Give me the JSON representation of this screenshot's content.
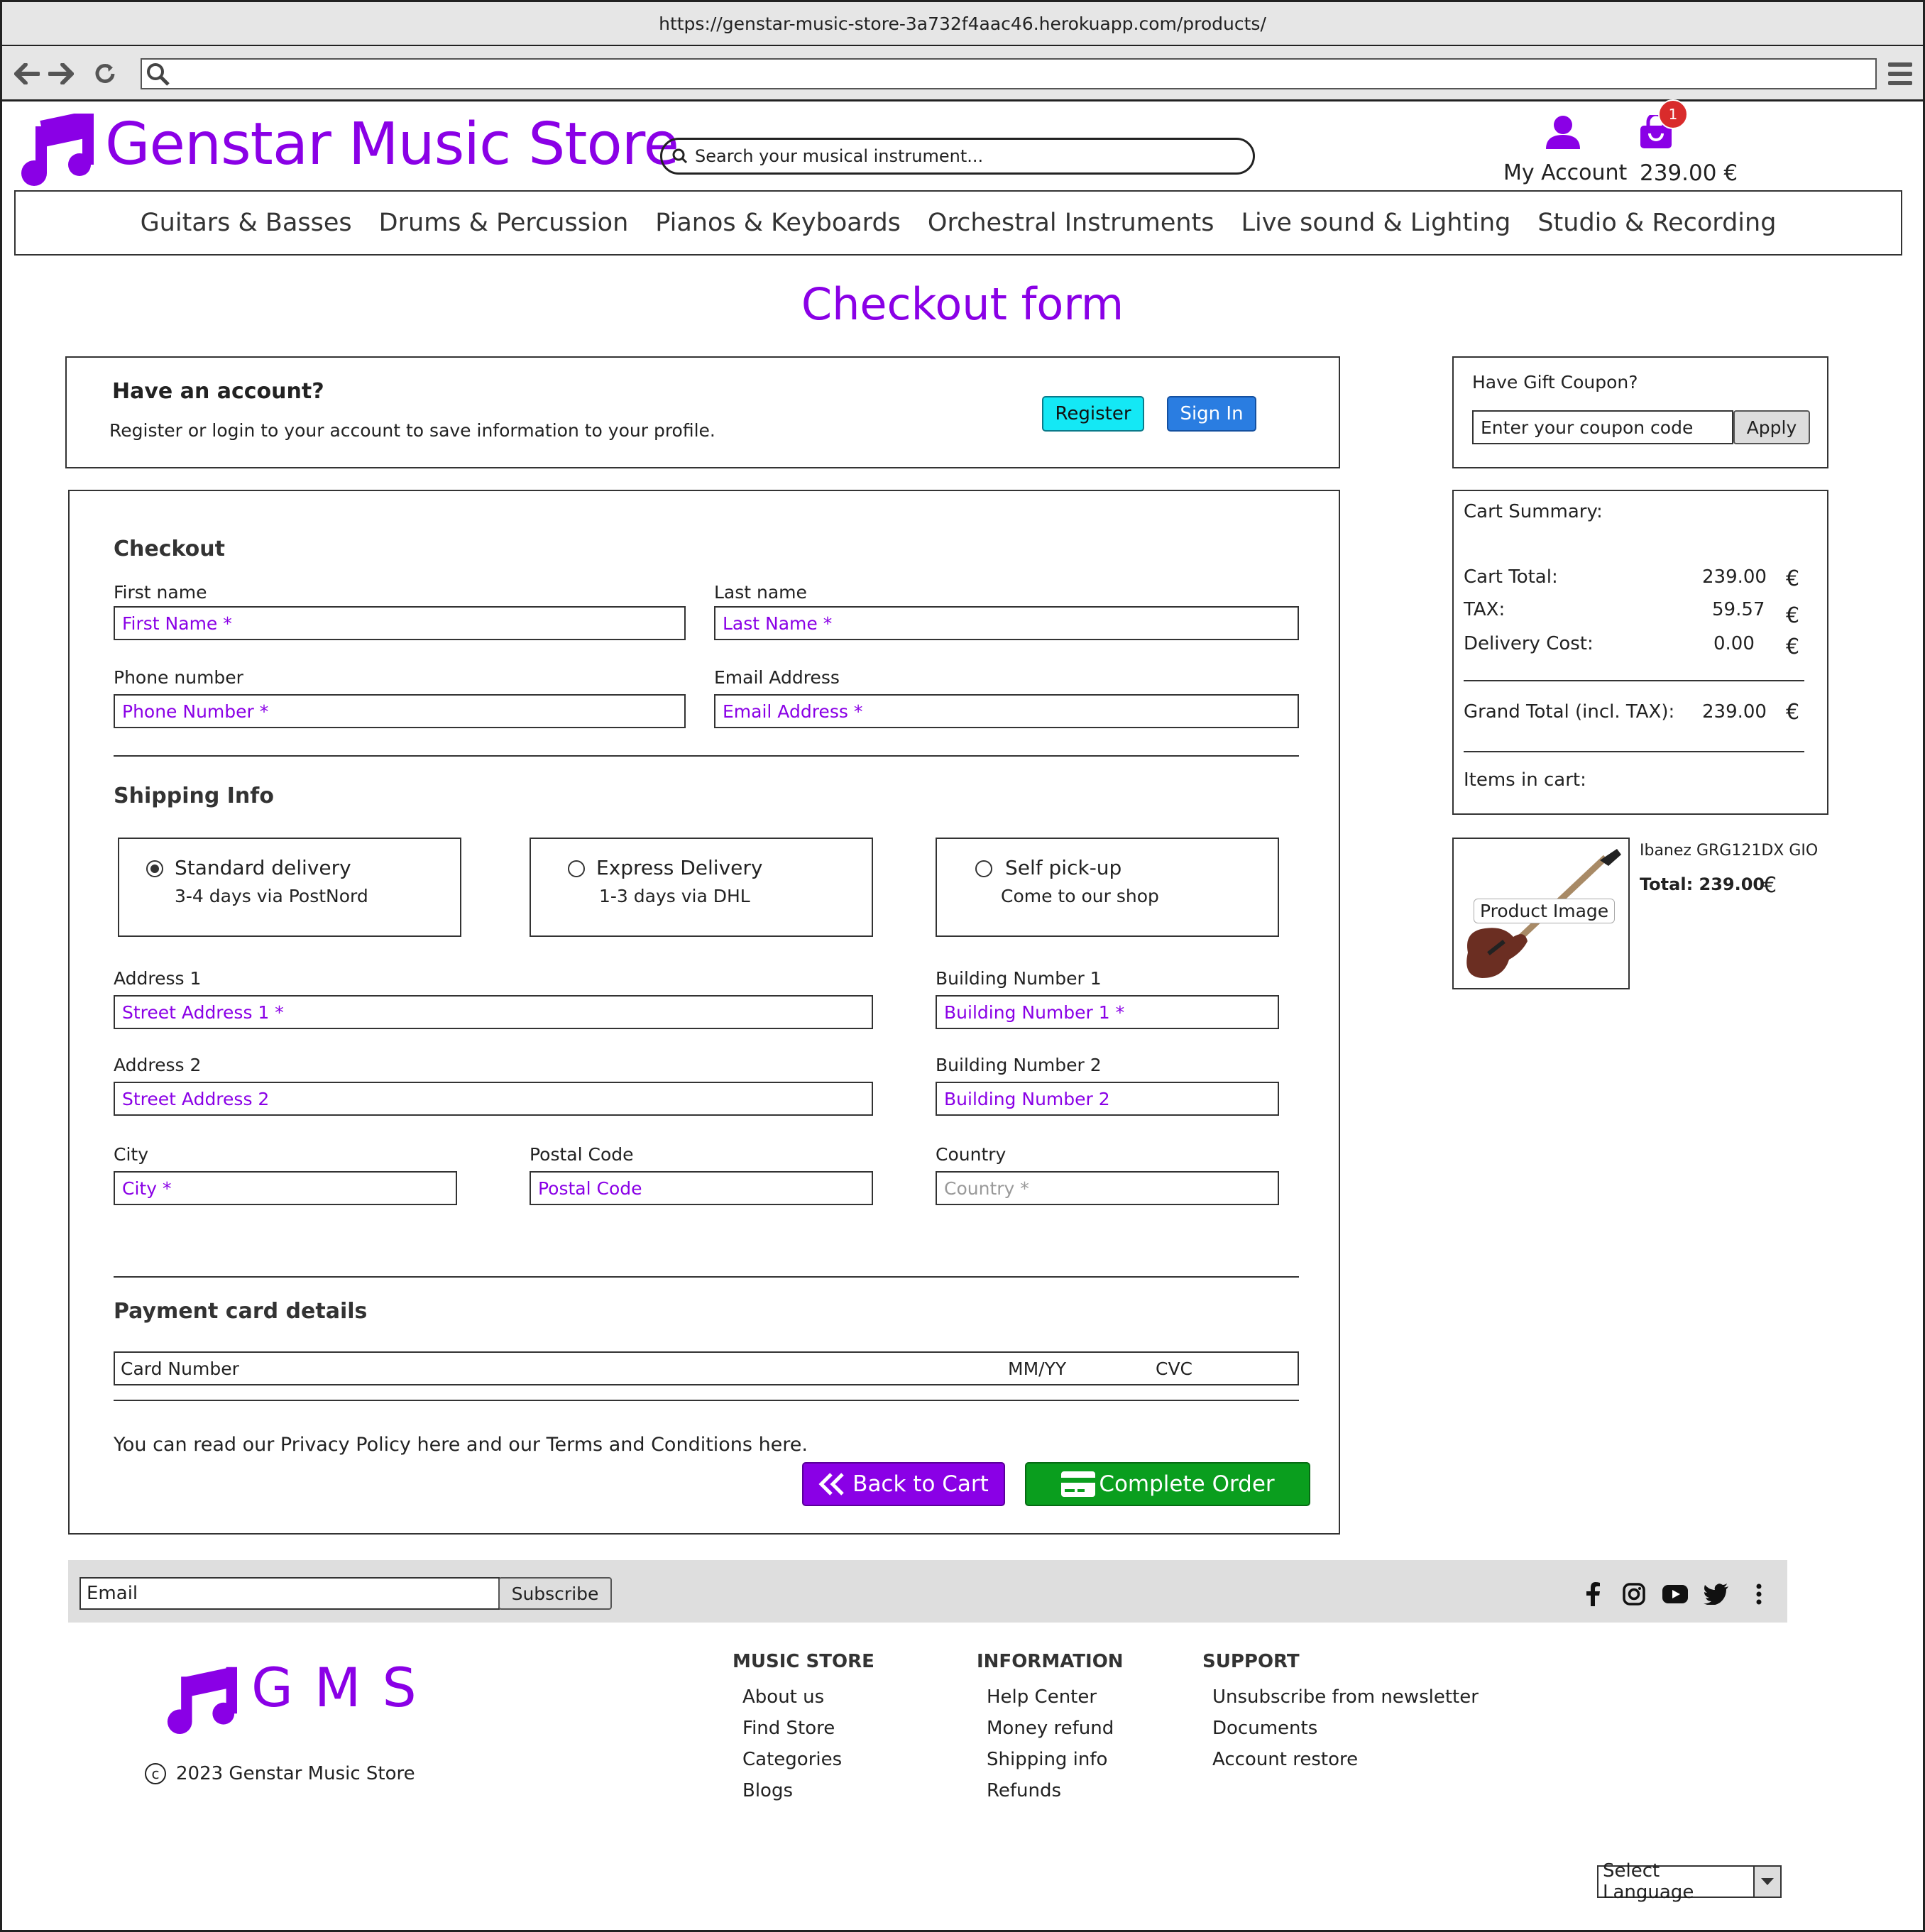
{
  "browser": {
    "url": "https://genstar-music-store-3a732f4aac46.herokuapp.com/products/",
    "back_icon": "arrow-left-icon",
    "forward_icon": "arrow-right-icon",
    "reload_icon": "reload-icon",
    "search_icon": "search-icon",
    "menu_icon": "hamburger-menu-icon"
  },
  "header": {
    "title": "Genstar Music Store",
    "search_placeholder": "Search your musical instrument...",
    "account_label": "My Account",
    "cart_total": "239.00 €",
    "cart_count": "1"
  },
  "nav": [
    "Guitars & Basses",
    "Drums & Percussion",
    "Pianos & Keyboards",
    "Orchestral Instruments",
    "Live sound & Lighting",
    "Studio & Recording"
  ],
  "page_title": "Checkout form",
  "account_box": {
    "heading": "Have an account?",
    "text": "Register or login to your account to save information to your profile.",
    "register": "Register",
    "signin": "Sign In"
  },
  "coupon": {
    "label": "Have Gift Coupon?",
    "placeholder": "Enter your coupon code",
    "apply": "Apply"
  },
  "checkout": {
    "heading": "Checkout",
    "first_name_label": "First name",
    "first_name_ph": "First Name *",
    "last_name_label": "Last name",
    "last_name_ph": "Last Name *",
    "phone_label": "Phone number",
    "phone_ph": "Phone Number *",
    "email_label": "Email Address",
    "email_ph": "Email Address *"
  },
  "shipping": {
    "heading": "Shipping Info",
    "options": [
      {
        "title": "Standard delivery",
        "sub": "3-4 days via PostNord",
        "selected": true
      },
      {
        "title": "Express Delivery",
        "sub": "1-3 days via DHL",
        "selected": false
      },
      {
        "title": "Self pick-up",
        "sub": "Come to our shop",
        "selected": false
      }
    ],
    "address1_label": "Address 1",
    "address1_ph": "Street Address 1 *",
    "building1_label": "Building Number 1",
    "building1_ph": "Building Number 1 *",
    "address2_label": "Address 2",
    "address2_ph": "Street Address 2",
    "building2_label": "Building Number 2",
    "building2_ph": "Building Number 2",
    "city_label": "City",
    "city_ph": "City *",
    "postal_label": "Postal Code",
    "postal_ph": "Postal Code",
    "country_label": "Country",
    "country_ph": "Country *"
  },
  "payment": {
    "heading": "Payment card details",
    "card_number": "Card Number",
    "mmyy": "MM/YY",
    "cvc": "CVC"
  },
  "policy_text": "You can read our Privacy Policy here and our Terms and Conditions here.",
  "buttons": {
    "back": "Back to Cart",
    "complete": "Complete Order"
  },
  "summary": {
    "heading": "Cart Summary:",
    "cart_total_label": "Cart Total:",
    "cart_total": "239.00",
    "tax_label": "TAX:",
    "tax": "59.57",
    "delivery_label": "Delivery Cost:",
    "delivery": "0.00",
    "grand_label": "Grand Total (incl. TAX):",
    "grand": "239.00",
    "currency": "€",
    "items_label": "Items in cart:"
  },
  "cart_item": {
    "image_label": "Product Image",
    "name": "Ibanez GRG121DX GIO",
    "total": "Total: 239.00",
    "currency": "€"
  },
  "footer": {
    "email_placeholder": "Email",
    "subscribe": "Subscribe",
    "social_icons": [
      "facebook-icon",
      "instagram-icon",
      "youtube-icon",
      "twitter-icon",
      "more-vertical-icon"
    ],
    "brand": "GMS",
    "copyright": "2023 Genstar Music Store",
    "columns": [
      {
        "heading": "MUSIC STORE",
        "links": [
          "About us",
          "Find Store",
          "Categories",
          "Blogs"
        ]
      },
      {
        "heading": "INFORMATION",
        "links": [
          "Help Center",
          "Money refund",
          "Shipping info",
          "Refunds"
        ]
      },
      {
        "heading": "SUPPORT",
        "links": [
          "Unsubscribe from newsletter",
          "Documents",
          "Account restore"
        ]
      }
    ],
    "language": "Select Language"
  },
  "colors": {
    "brand": "#8a00e6",
    "register": "#14e8f5",
    "signin": "#2a7de1",
    "complete": "#0a9e1e",
    "badge": "#d92b2b"
  }
}
